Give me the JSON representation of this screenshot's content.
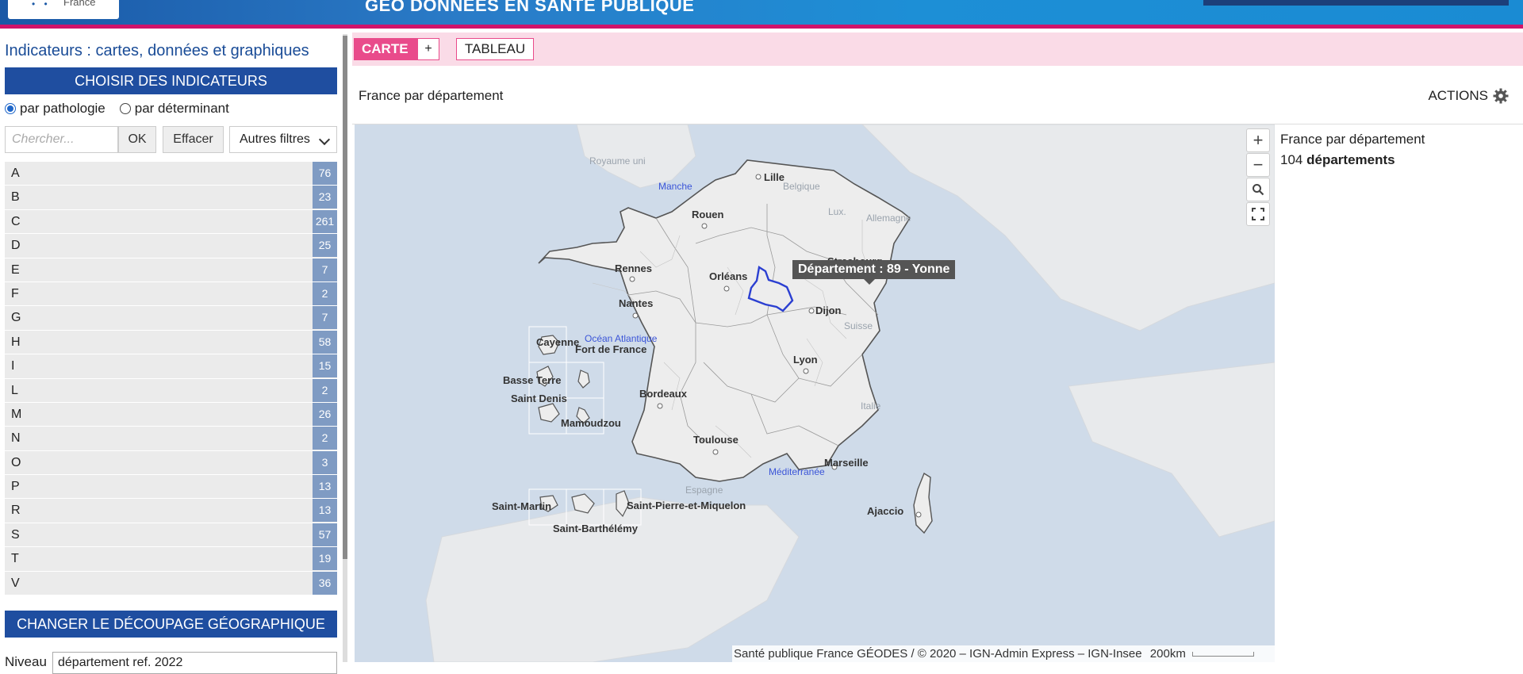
{
  "header": {
    "logo_text": "France",
    "app_title": "GÉO DONNÉES EN SANTÉ PUBLIQUE"
  },
  "sidebar": {
    "title": "Indicateurs : cartes, données et graphiques",
    "choose_band": "CHOISIR DES INDICATEURS",
    "radio_pathologie": "par pathologie",
    "radio_determinant": "par déterminant",
    "search_placeholder": "Chercher...",
    "ok_label": "OK",
    "clear_label": "Effacer",
    "filters_label": "Autres filtres",
    "indicators": [
      {
        "letter": "A",
        "count": "76"
      },
      {
        "letter": "B",
        "count": "23"
      },
      {
        "letter": "C",
        "count": "261"
      },
      {
        "letter": "D",
        "count": "25"
      },
      {
        "letter": "E",
        "count": "7"
      },
      {
        "letter": "F",
        "count": "2"
      },
      {
        "letter": "G",
        "count": "7"
      },
      {
        "letter": "H",
        "count": "58"
      },
      {
        "letter": "I",
        "count": "15"
      },
      {
        "letter": "L",
        "count": "2"
      },
      {
        "letter": "M",
        "count": "26"
      },
      {
        "letter": "N",
        "count": "2"
      },
      {
        "letter": "O",
        "count": "3"
      },
      {
        "letter": "P",
        "count": "13"
      },
      {
        "letter": "R",
        "count": "13"
      },
      {
        "letter": "S",
        "count": "57"
      },
      {
        "letter": "T",
        "count": "19"
      },
      {
        "letter": "V",
        "count": "36"
      }
    ],
    "geo_band": "CHANGER LE DÉCOUPAGE GÉOGRAPHIQUE",
    "niveau_label": "Niveau",
    "niveau_value": "département ref. 2022"
  },
  "tabs": {
    "carte": "CARTE",
    "plus": "+",
    "tableau": "TABLEAU"
  },
  "map_panel": {
    "title": "France par département",
    "actions_label": "ACTIONS",
    "tooltip": "Département : 89 - Yonne",
    "attribution": "Santé publique France GÉODES / © 2020 – IGN-Admin Express – IGN-Insee",
    "scale": "200km",
    "labels": {
      "lille": "Lille",
      "rouen": "Rouen",
      "rennes": "Rennes",
      "nantes": "Nantes",
      "orleans": "Orléans",
      "dijon": "Dijon",
      "strasbourg": "Strasbourg",
      "lyon": "Lyon",
      "bordeaux": "Bordeaux",
      "toulouse": "Toulouse",
      "marseille": "Marseille",
      "ajaccio": "Ajaccio",
      "cayenne": "Cayenne",
      "fort_de_france": "Fort de France",
      "basse_terre": "Basse Terre",
      "saint_denis": "Saint Denis",
      "mamoudzou": "Mamoudzou",
      "saint_martin": "Saint-Martin",
      "saint_barthelemy": "Saint-Barthélémy",
      "saint_pierre": "Saint-Pierre-et-Miquelon",
      "royaume_uni": "Royaume uni",
      "belgique": "Belgique",
      "lux": "Lux.",
      "allemagne": "Allemagne",
      "suisse": "Suisse",
      "italie": "Italie",
      "espagne": "Espagne",
      "manche": "Manche",
      "ocean": "Océan Atlantique",
      "mediterranee": "Méditerranée"
    }
  },
  "info_panel": {
    "line1": "France par département",
    "count": "104",
    "unit": "départements"
  }
}
